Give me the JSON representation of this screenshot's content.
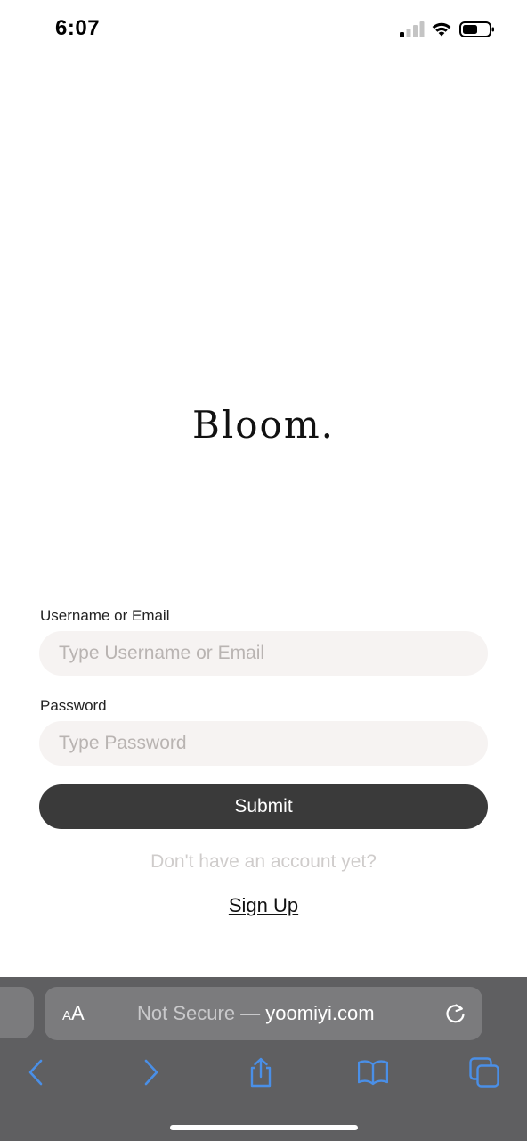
{
  "status_bar": {
    "time": "6:07",
    "signal_icon": "cellular-signal-icon",
    "wifi_icon": "wifi-icon",
    "battery_icon": "battery-icon"
  },
  "brand": {
    "name": "Bloom."
  },
  "login_form": {
    "username_label": "Username or Email",
    "username_placeholder": "Type Username or Email",
    "username_value": "",
    "password_label": "Password",
    "password_placeholder": "Type Password",
    "password_value": "",
    "submit_label": "Submit",
    "signup_prompt": "Don't have an account yet?",
    "signup_link": "Sign Up"
  },
  "browser": {
    "text_size_button_small": "A",
    "text_size_button_large": "A",
    "security_label": "Not Secure —",
    "domain": "yoomiyi.com",
    "toolbar": [
      "back-icon",
      "forward-icon",
      "share-icon",
      "bookmarks-icon",
      "tabs-icon"
    ],
    "accent_color": "#4a8fe7"
  },
  "colors": {
    "button_dark": "#3a3a3a",
    "input_background": "#f6f3f2",
    "chrome_background": "#5f5f61"
  }
}
